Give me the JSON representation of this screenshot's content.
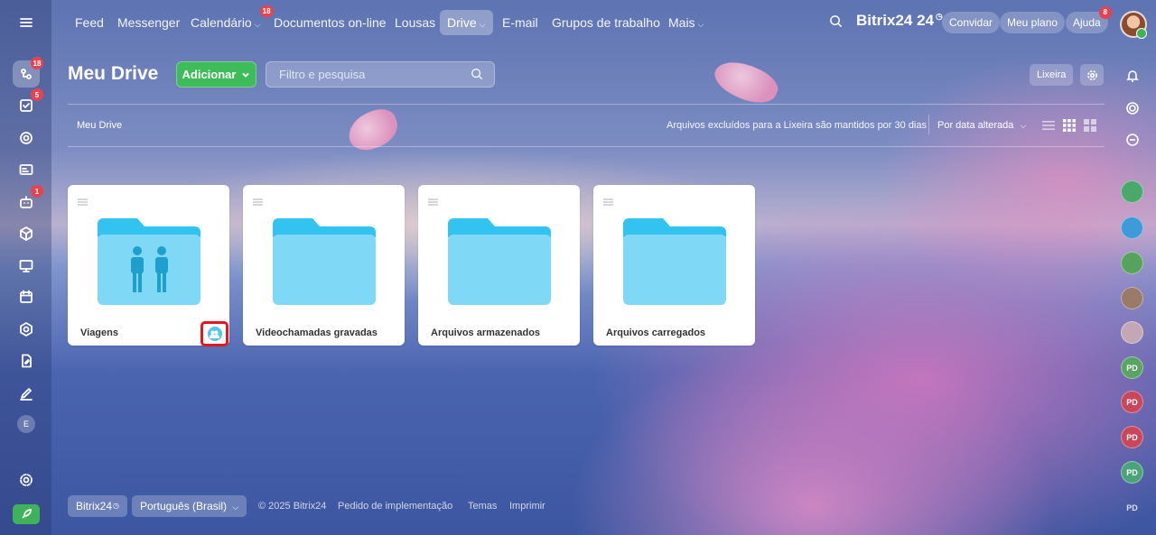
{
  "top_nav": {
    "items": [
      {
        "label": "Feed"
      },
      {
        "label": "Messenger"
      },
      {
        "label": "Calendário",
        "badge": "18"
      },
      {
        "label": "Documentos on-line"
      },
      {
        "label": "Lousas"
      },
      {
        "label": "Drive"
      },
      {
        "label": "E-mail"
      },
      {
        "label": "Grupos de trabalho"
      },
      {
        "label": "Mais"
      }
    ],
    "brand": "Bitrix24",
    "brand_suffix": "24",
    "invite": "Convidar",
    "my_plan": "Meu plano",
    "help": "Ajuda",
    "help_badge": "8"
  },
  "left_rail": {
    "badges": {
      "activity": "18",
      "tasks": "5",
      "automation": "1"
    },
    "user_initial": "E"
  },
  "header": {
    "title": "Meu Drive",
    "add_label": "Adicionar",
    "search_placeholder": "Filtro e pesquisa",
    "trash_label": "Lixeira"
  },
  "toolbar": {
    "breadcrumb": "Meu Drive",
    "retention_note": "Arquivos excluídos para a Lixeira são mantidos por 30 dias",
    "sort_label": "Por data alterada"
  },
  "folders": [
    {
      "name": "Viagens",
      "shared": true
    },
    {
      "name": "Videochamadas gravadas",
      "shared": false
    },
    {
      "name": "Arquivos armazenados",
      "shared": false
    },
    {
      "name": "Arquivos carregados",
      "shared": false
    }
  ],
  "right_rail": {
    "initials": [
      "PD",
      "PD",
      "PD",
      "PD",
      "PD"
    ]
  },
  "footer": {
    "brand": "Bitrix24",
    "language": "Português (Brasil)",
    "copyright": "© 2025 Bitrix24",
    "links": [
      "Pedido de implementação",
      "Temas",
      "Imprimir"
    ]
  },
  "colors": {
    "accent_green": "#3ebc5a",
    "badge_red": "#e9424f",
    "folder_blue": "#7fd8f5",
    "folder_tab": "#33c3f0",
    "highlight_red": "#e4171e"
  }
}
